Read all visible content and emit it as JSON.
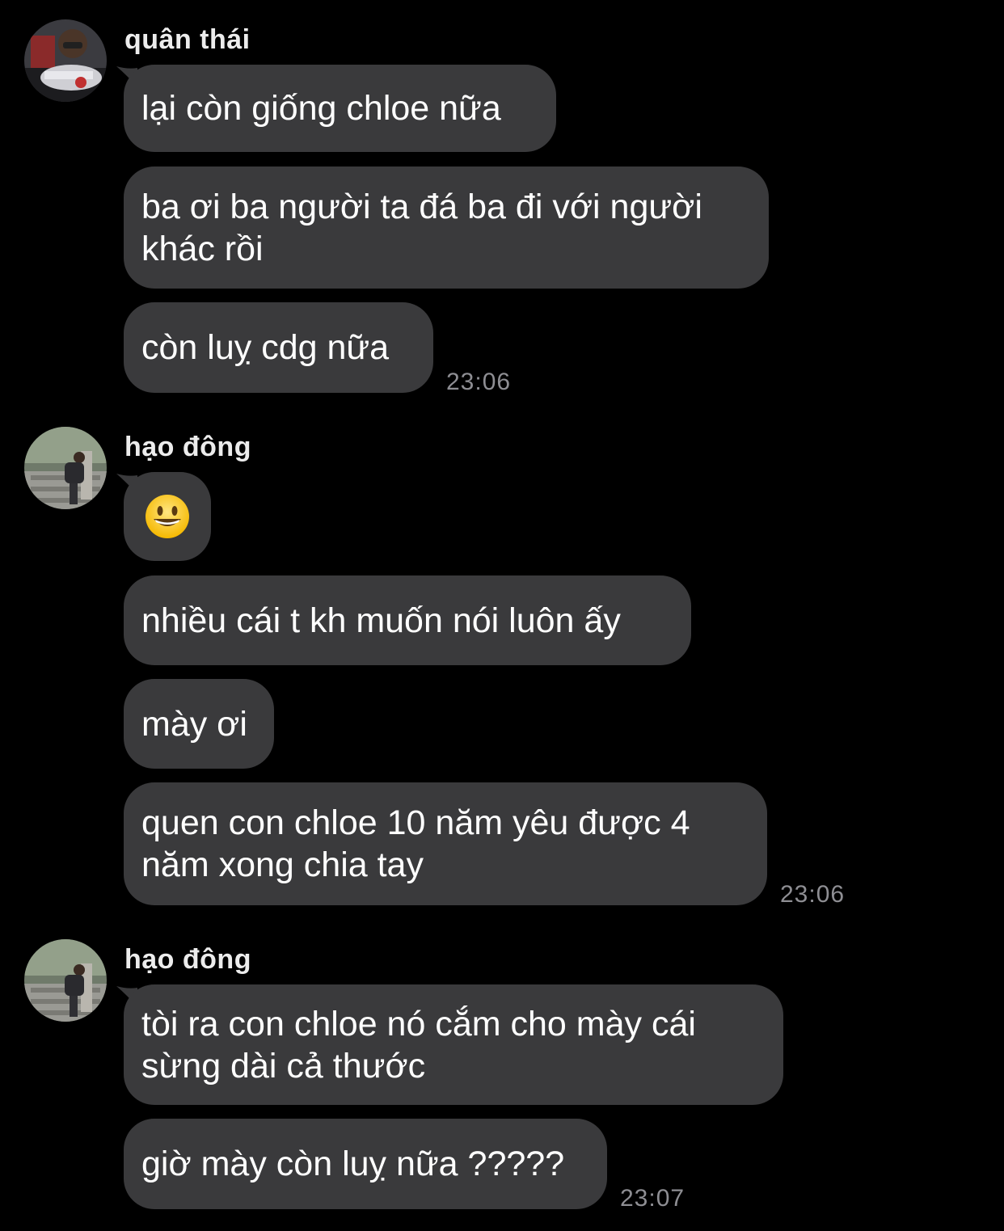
{
  "messages": {
    "group1": {
      "sender": "quân thái",
      "bubbles": [
        "lại còn giống chloe nữa",
        "ba ơi ba người ta đá ba đi với người\nkhác rồi",
        "còn luỵ cdg nữa"
      ],
      "time": "23:06"
    },
    "group2": {
      "sender": "hạo đông",
      "emoji": "grinning-face",
      "bubbles": [
        "nhiều cái t kh muốn nói luôn ấy",
        "mày ơi",
        "quen con chloe 10 năm yêu được 4\nnăm xong chia tay"
      ],
      "time": "23:06"
    },
    "group3": {
      "sender": "hạo đông",
      "bubbles": [
        "tòi ra con chloe nó cắm cho mày cái\nsừng dài cả thước",
        "giờ mày còn luỵ nữa ?????"
      ],
      "time": "23:07"
    }
  },
  "colors": {
    "background": "#000000",
    "bubble": "#3a3a3c",
    "timestamp": "#8e8e93"
  }
}
